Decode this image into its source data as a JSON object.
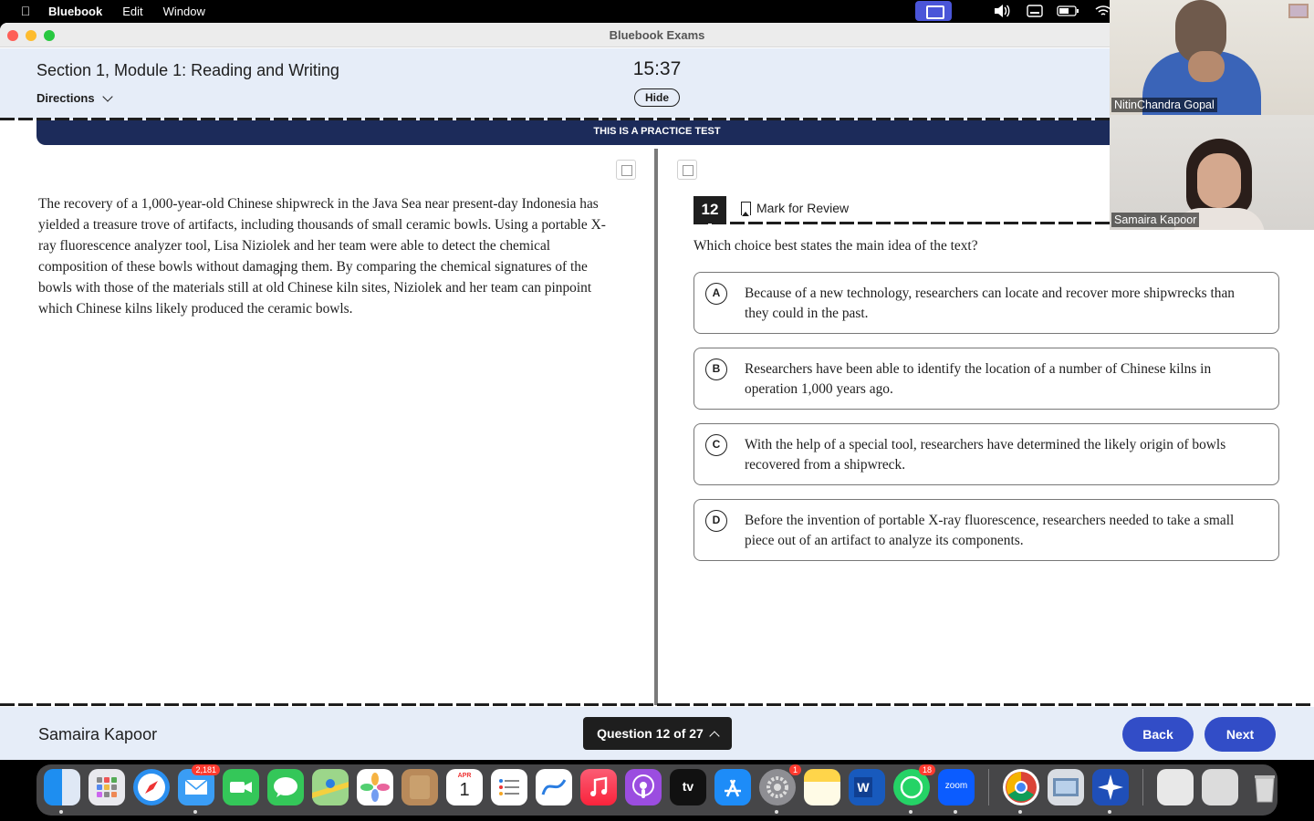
{
  "menubar": {
    "app": "Bluebook",
    "items": [
      "Edit",
      "Window"
    ]
  },
  "window": {
    "title": "Bluebook Exams"
  },
  "header": {
    "section_title": "Section 1, Module 1: Reading and Writing",
    "directions_label": "Directions",
    "timer": "15:37",
    "hide_label": "Hide",
    "banner": "THIS IS A PRACTICE TEST"
  },
  "passage": {
    "text": "The recovery of a 1,000-year-old Chinese shipwreck in the Java Sea near present-day Indonesia has yielded a treasure trove of artifacts, including thousands of small ceramic bowls. Using a portable X-ray fluorescence analyzer tool, Lisa Niziolek and her team were able to detect the chemical composition of these bowls without damaging them. By comparing the chemical signatures of the bowls with those of the materials still at old Chinese kiln sites, Niziolek and her team can pinpoint which Chinese kilns likely produced the ceramic bowls."
  },
  "question": {
    "number": "12",
    "mark_for_review": "Mark for Review",
    "prompt": "Which choice best states the main idea of the text?",
    "choices": [
      {
        "letter": "A",
        "text": "Because of a new technology, researchers can locate and recover more shipwrecks than they could in the past."
      },
      {
        "letter": "B",
        "text": "Researchers have been able to identify the location of a number of Chinese kilns in operation 1,000 years ago."
      },
      {
        "letter": "C",
        "text": "With the help of a special tool, researchers have determined the likely origin of bowls recovered from a shipwreck."
      },
      {
        "letter": "D",
        "text": "Before the invention of portable X-ray fluorescence, researchers needed to take a small piece out of an artifact to analyze its components."
      }
    ]
  },
  "footer": {
    "student_name": "Samaira Kapoor",
    "question_nav": "Question 12 of 27",
    "back_label": "Back",
    "next_label": "Next"
  },
  "video": {
    "participant1": "NitinChandra Gopal",
    "participant2": "Samaira Kapoor"
  },
  "dock": {
    "mail_badge": "2,181",
    "settings_badge": "1",
    "whatsapp_badge": "18",
    "calendar_month": "APR",
    "calendar_day": "1",
    "tv_label": "tv",
    "zoom_label": "zoom"
  },
  "colors": {
    "header_bg": "#e6edf8",
    "banner_bg": "#1c2b5a",
    "button_blue": "#324dc7",
    "text": "#1e1e1e"
  }
}
